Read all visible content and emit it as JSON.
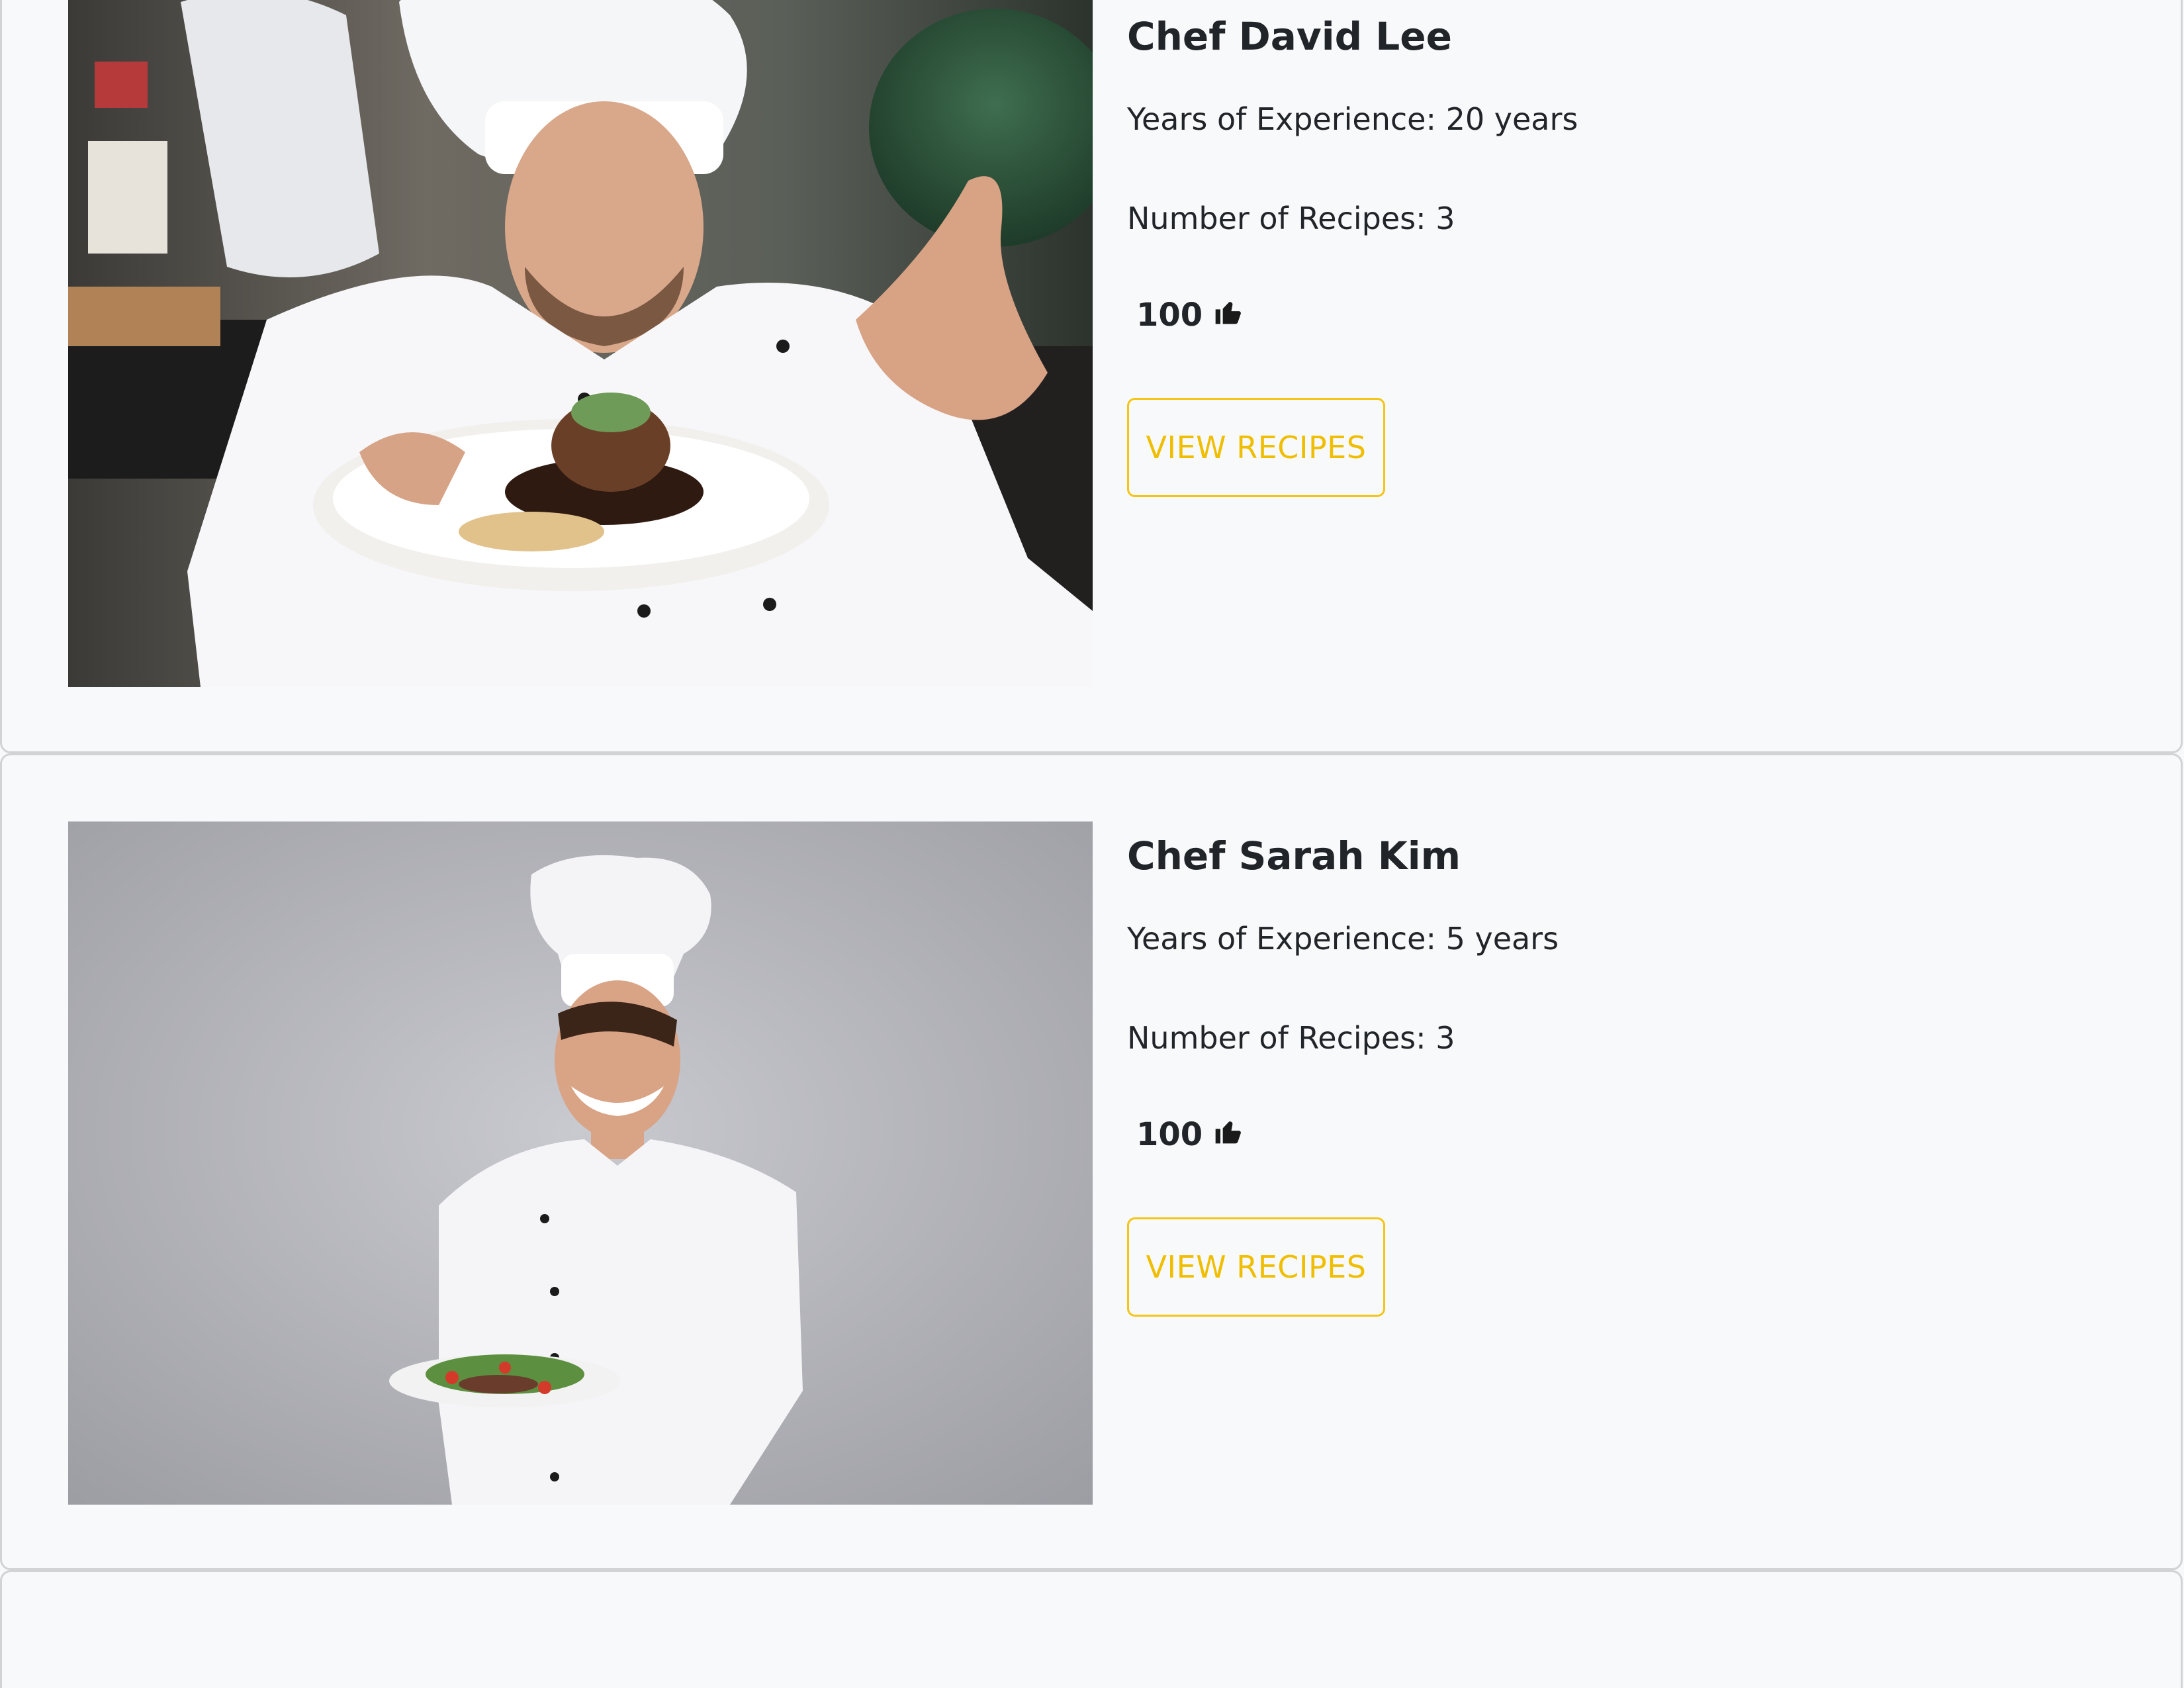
{
  "chefs": [
    {
      "name": "Chef David Lee",
      "experience": "Years of Experience: 20 years",
      "recipes": "Number of Recipes: 3",
      "likes": "100",
      "button_label": "VIEW RECIPES",
      "photo_alt": "Chef smelling a plated dish in a kitchen"
    },
    {
      "name": "Chef Sarah Kim",
      "experience": "Years of Experience: 5 years",
      "recipes": "Number of Recipes: 3",
      "likes": "100",
      "button_label": "VIEW RECIPES",
      "photo_alt": "Smiling chef holding a salad plate"
    }
  ],
  "icons": {
    "likes": "thumbs-up-icon"
  },
  "colors": {
    "page_background": "#f8f9fa",
    "card_border": "#d2d3d5",
    "accent_button": "#f4c516",
    "text": "#212529"
  }
}
